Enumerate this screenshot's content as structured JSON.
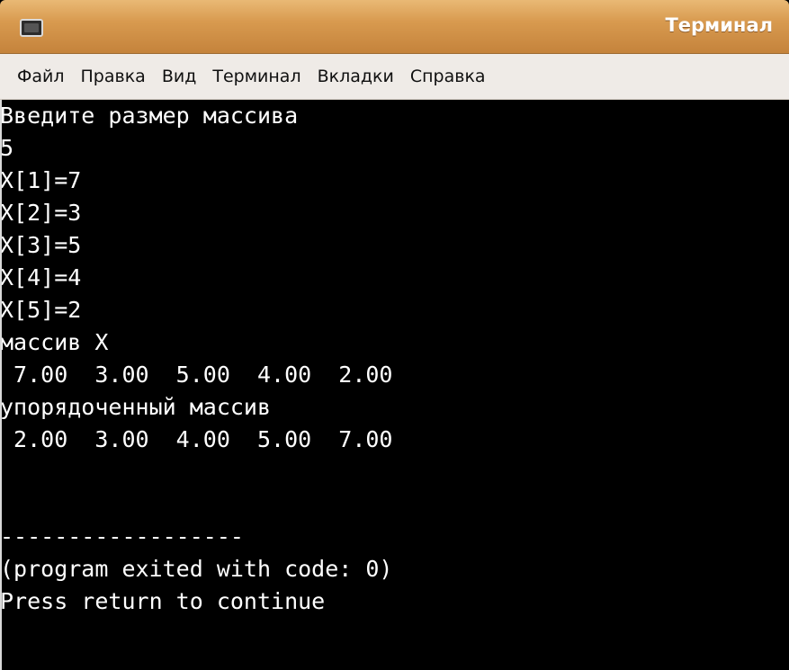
{
  "window": {
    "title": "Терминал"
  },
  "menu": {
    "items": [
      "Файл",
      "Правка",
      "Вид",
      "Терминал",
      "Вкладки",
      "Справка"
    ]
  },
  "terminal": {
    "lines": [
      "Введите размер массива",
      "5",
      "X[1]=7",
      "X[2]=3",
      "X[3]=5",
      "X[4]=4",
      "X[5]=2",
      "массив X",
      " 7.00  3.00  5.00  4.00  2.00",
      "упорядоченный массив",
      " 2.00  3.00  4.00  5.00  7.00",
      "",
      "",
      "------------------",
      "(program exited with code: 0)",
      "Press return to continue"
    ]
  }
}
